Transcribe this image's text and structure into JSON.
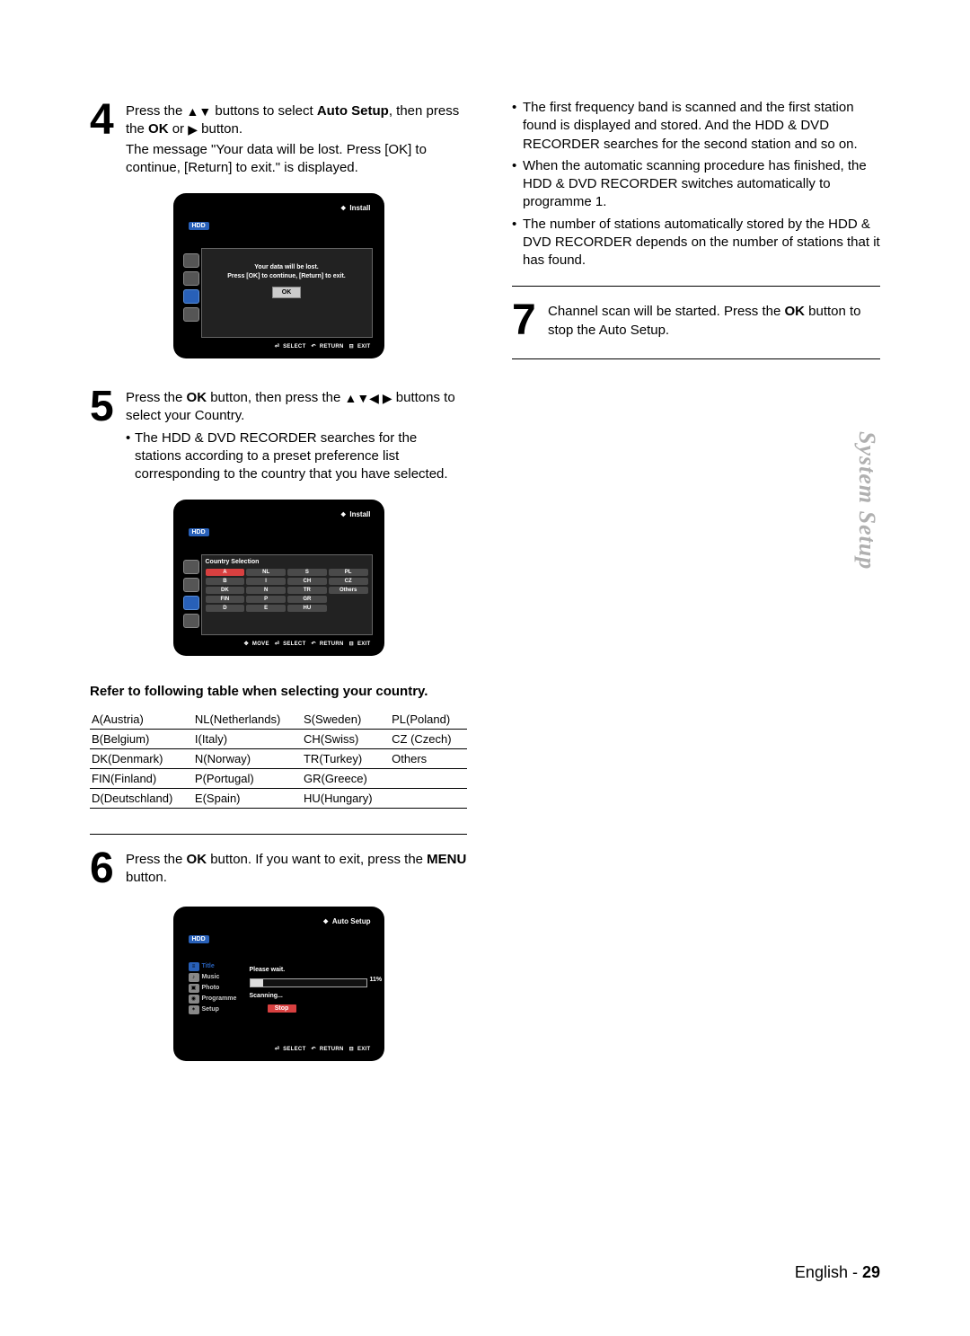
{
  "section_tab": "System Setup",
  "footer_lang": "English",
  "footer_sep": " - ",
  "footer_page": "29",
  "steps": {
    "4": {
      "num": "4",
      "text_parts": [
        {
          "t": "Press the ",
          "b": false
        },
        {
          "t": "▲▼",
          "b": false,
          "sym": true
        },
        {
          "t": " buttons to select ",
          "b": false
        },
        {
          "t": "Auto Setup",
          "b": true
        },
        {
          "t": ", then press the ",
          "b": false
        },
        {
          "t": "OK",
          "b": true
        },
        {
          "t": " or ",
          "b": false
        },
        {
          "t": "▶",
          "b": false,
          "sym": true
        },
        {
          "t": " button.",
          "b": false
        }
      ],
      "line2": "The message \"Your data will be lost. Press [OK] to continue, [Return] to exit.\" is displayed."
    },
    "5": {
      "num": "5",
      "text_parts": [
        {
          "t": "Press the ",
          "b": false
        },
        {
          "t": "OK",
          "b": true
        },
        {
          "t": " button, then press the ",
          "b": false
        },
        {
          "t": "▲▼◀ ▶",
          "b": false,
          "sym": true
        },
        {
          "t": " buttons to select your Country.",
          "b": false
        }
      ],
      "bullet": "The HDD & DVD RECORDER searches for the stations according to a preset preference list corresponding to the country that you have selected."
    },
    "6": {
      "num": "6",
      "text_parts": [
        {
          "t": "Press the ",
          "b": false
        },
        {
          "t": "OK",
          "b": true
        },
        {
          "t": " button. If you want to exit, press the ",
          "b": false
        },
        {
          "t": "MENU",
          "b": true
        },
        {
          "t": " button.",
          "b": false
        }
      ]
    },
    "7": {
      "num": "7",
      "text_parts": [
        {
          "t": "Channel scan will be started. Press the ",
          "b": false
        },
        {
          "t": "OK",
          "b": true
        },
        {
          "t": " button to stop the Auto Setup.",
          "b": false
        }
      ]
    }
  },
  "right_bullets": [
    "The first frequency band is scanned and the first station found is displayed and stored. And the HDD & DVD RECORDER searches for the second station and so on.",
    "When the automatic scanning procedure has finished, the HDD & DVD RECORDER switches automatically to programme 1.",
    "The number of stations automatically stored by the HDD & DVD RECORDER depends on the number of stations that it has found."
  ],
  "tv1": {
    "header": "Install",
    "hdd": "HDD",
    "modal_l1": "Your data will be lost.",
    "modal_l2": "Press [OK] to continue, [Return] to exit.",
    "ok": "OK",
    "footer": {
      "select": "SELECT",
      "return": "RETURN",
      "exit": "EXIT"
    }
  },
  "tv2": {
    "header": "Install",
    "hdd": "HDD",
    "panel_title": "Country Selection",
    "grid": [
      [
        "A",
        "NL",
        "S",
        "PL"
      ],
      [
        "B",
        "I",
        "CH",
        "CZ"
      ],
      [
        "DK",
        "N",
        "TR",
        "Others"
      ],
      [
        "FIN",
        "P",
        "GR",
        ""
      ],
      [
        "D",
        "E",
        "HU",
        ""
      ]
    ],
    "highlight": "A",
    "footer": {
      "move": "MOVE",
      "select": "SELECT",
      "return": "RETURN",
      "exit": "EXIT"
    }
  },
  "tv3": {
    "header": "Auto Setup",
    "hdd": "HDD",
    "menu": [
      {
        "icon": "≡",
        "label": "Title",
        "active": true
      },
      {
        "icon": "♪",
        "label": "Music",
        "active": false
      },
      {
        "icon": "▣",
        "label": "Photo",
        "active": false
      },
      {
        "icon": "◉",
        "label": "Programme",
        "active": false
      },
      {
        "icon": "✶",
        "label": "Setup",
        "active": false
      }
    ],
    "please_wait": "Please wait.",
    "scanning": "Scanning...",
    "pct": "11%",
    "stop": "Stop",
    "footer": {
      "select": "SELECT",
      "return": "RETURN",
      "exit": "EXIT"
    }
  },
  "table_caption": "Refer to following table when selecting your country.",
  "country_table": [
    [
      "A(Austria)",
      "NL(Netherlands)",
      "S(Sweden)",
      "PL(Poland)"
    ],
    [
      "B(Belgium)",
      "I(Italy)",
      "CH(Swiss)",
      "CZ (Czech)"
    ],
    [
      "DK(Denmark)",
      "N(Norway)",
      "TR(Turkey)",
      "Others"
    ],
    [
      "FIN(Finland)",
      "P(Portugal)",
      "GR(Greece)",
      ""
    ],
    [
      "D(Deutschland)",
      "E(Spain)",
      "HU(Hungary)",
      ""
    ]
  ]
}
